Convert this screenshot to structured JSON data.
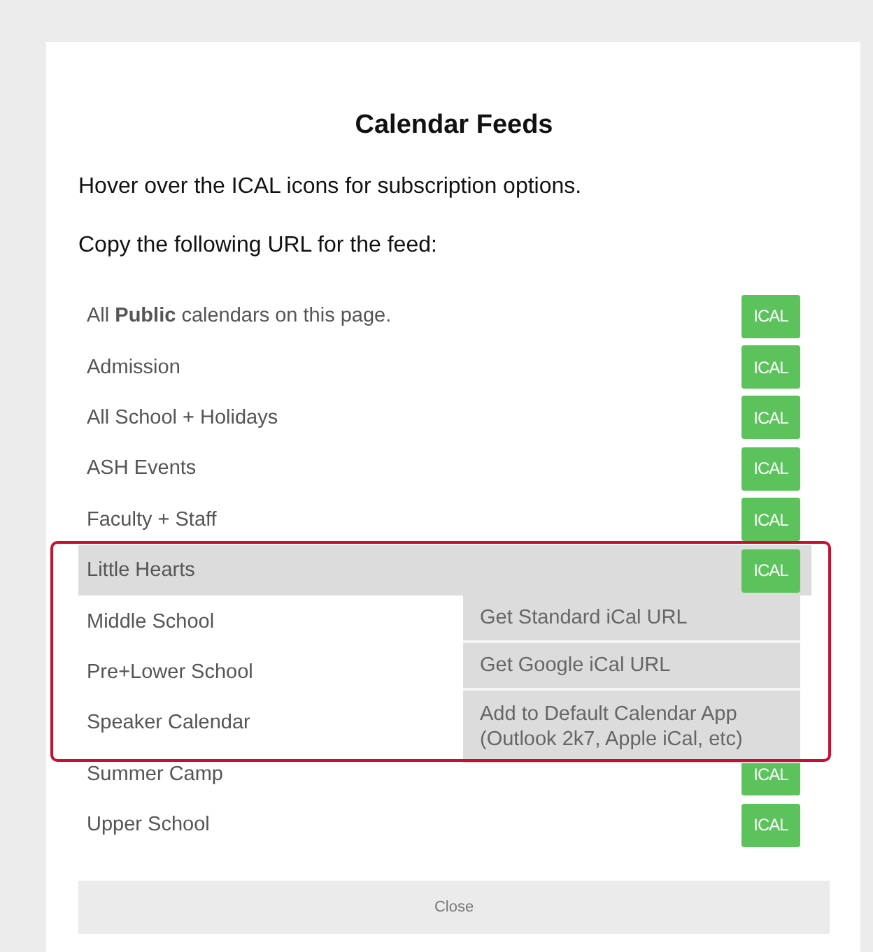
{
  "dialog": {
    "title": "Calendar Feeds",
    "paragraphs": [
      "Hover over the ICAL icons for subscription options.",
      "Copy the following URL for the feed:"
    ],
    "feeds": [
      {
        "label": "All **Public** calendars on this page.",
        "selected": false,
        "button": "ICAL"
      },
      {
        "label": "Admission",
        "selected": false,
        "button": "ICAL"
      },
      {
        "label": "All School + Holidays",
        "selected": false,
        "button": "ICAL"
      },
      {
        "label": "ASH Events",
        "selected": false,
        "button": "ICAL"
      },
      {
        "label": "Faculty + Staff",
        "selected": false,
        "button": "ICAL"
      },
      {
        "label": "Little Hearts",
        "selected": true,
        "button": "ICAL"
      },
      {
        "label": "Middle School",
        "selected": false
      },
      {
        "label": "Pre+Lower School",
        "selected": false
      },
      {
        "label": "Speaker Calendar",
        "selected": false
      },
      {
        "label": "Summer Camp",
        "selected": false,
        "button": "ICAL"
      },
      {
        "label": "Upper School",
        "selected": false,
        "button": "ICAL"
      }
    ],
    "subscription_menu": [
      "Get Standard iCal URL",
      "Get Google iCal URL",
      "Add to Default Calendar App (Outlook 2k7, Apple iCal, etc)"
    ],
    "highlight_frame": true,
    "close_button": "Close"
  }
}
